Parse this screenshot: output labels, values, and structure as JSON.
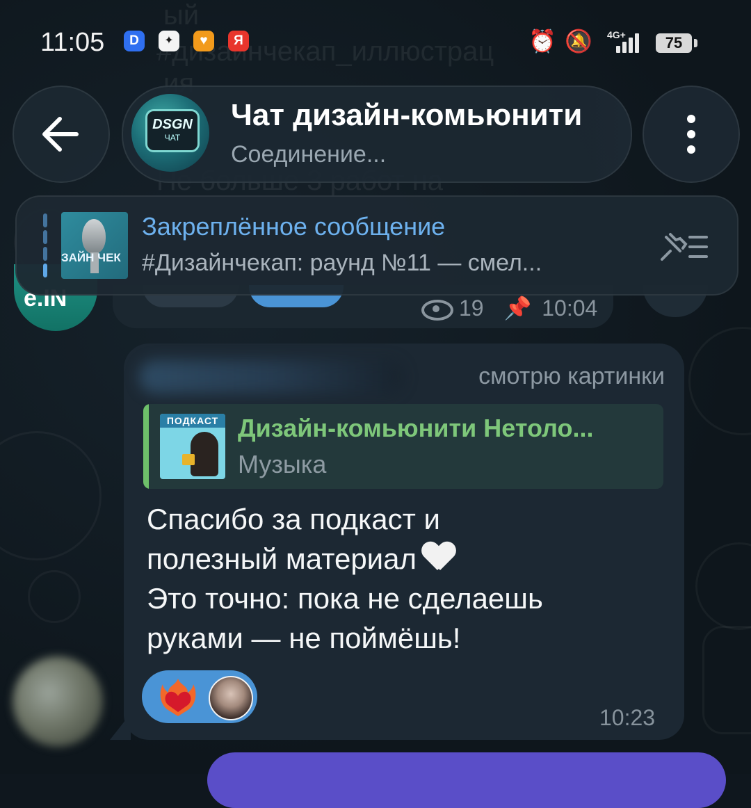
{
  "status_bar": {
    "time": "11:05",
    "notification_icons": [
      {
        "name": "messenger-icon",
        "glyph": "D",
        "color": "#2f6ff0"
      },
      {
        "name": "dots-app-icon",
        "glyph": "⠿",
        "color": "#1d1d1d"
      },
      {
        "name": "heart-app-icon",
        "glyph": "♥",
        "color": "#f29a1b"
      },
      {
        "name": "yandex-icon",
        "glyph": "Я",
        "color": "#e8352c"
      }
    ],
    "network": "4G+",
    "battery": "75"
  },
  "background_ghost": {
    "line1": "ый",
    "line2": "#дизайнчекап_иллюстрац",
    "line3": "ия",
    "line4": "Не больше 3 работ на"
  },
  "header": {
    "chat_title": "Чат дизайн-комьюнити",
    "chat_status": "Соединение...",
    "avatar_text_1": "DSGN",
    "avatar_text_2": "ЧАТ"
  },
  "pinned": {
    "title": "Закреплённое сообщение",
    "text": "#Дизайнчекап: раунд №11 — смел...",
    "thumb_text": "ЗАЙН ЧЕК"
  },
  "previous_message": {
    "views": "19",
    "time": "10:04",
    "avatar_text": "e.IN"
  },
  "message": {
    "header_right": "смотрю картинки",
    "reply": {
      "title": "Дизайн-комьюнити Нетоло...",
      "subtitle": "Музыка",
      "thumb_header": "ПОДКАСТ"
    },
    "lines": [
      "Спасибо за подкаст и",
      "полезный материал",
      "Это точно: пока не сделаешь",
      "руками — не поймёшь!"
    ],
    "time": "10:23",
    "reaction": "heart-on-fire"
  },
  "colors": {
    "accent_blue": "#6db1ee",
    "reply_green": "#7ec77a",
    "bubble": "#1c2833",
    "reaction_pill": "#4a94d6",
    "outgoing": "#5a4ec8"
  }
}
